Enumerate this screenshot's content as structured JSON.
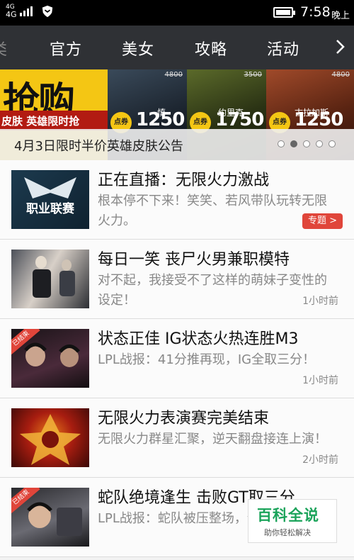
{
  "status_bar": {
    "network_top": "4G",
    "network": "4G",
    "time": "7:58",
    "ampm": "晚上"
  },
  "tabs": {
    "partial": "类",
    "items": [
      "官方",
      "美女",
      "攻略",
      "活动"
    ]
  },
  "banner": {
    "promo_big": "抢购",
    "promo_sub": "皮肤 英雄限时抢",
    "heroes": [
      {
        "name": "慎",
        "coin": "点券",
        "price": "1250",
        "old": "4800"
      },
      {
        "name": "约里克",
        "coin": "点券",
        "price": "1750",
        "old": "3500"
      },
      {
        "name": "古拉加斯",
        "coin": "点券",
        "price": "1250",
        "old": "4800"
      }
    ],
    "caption": "4月3日限时半价英雄皮肤公告",
    "slide_count": 5,
    "active_slide": 2
  },
  "news": [
    {
      "title": "正在直播：无限火力激战",
      "desc": "根本停不下来！笑笑、若风带队玩转无限火力。",
      "tag": "专题 >",
      "time": "",
      "thumb_text": "职业联赛",
      "ribbon": ""
    },
    {
      "title": "每日一笑 丧尸火男兼职模特",
      "desc": "对不起，我接受不了这样的萌妹子变性的设定！",
      "tag": "",
      "time": "1小时前",
      "thumb_text": "",
      "ribbon": ""
    },
    {
      "title": "状态正佳 IG状态火热连胜M3",
      "desc": "LPL战报：41分推再现，IG全取三分！",
      "tag": "",
      "time": "1小时前",
      "thumb_text": "",
      "ribbon": "已结束"
    },
    {
      "title": "无限火力表演赛完美结束",
      "desc": "无限火力群星汇聚，逆天翻盘接连上演！",
      "tag": "",
      "time": "2小时前",
      "thumb_text": "",
      "ribbon": ""
    },
    {
      "title": "蛇队绝境逢生 击败GT取三分",
      "desc": "LPL战报：蛇队被压整场，全取三分",
      "tag": "",
      "time": "",
      "thumb_text": "",
      "ribbon": "已结束"
    }
  ],
  "watermark": {
    "brand": "百科全说",
    "slogan": "助你轻松解决"
  },
  "colors": {
    "tabbar_bg": "#2f3135",
    "accent_red": "#e0453a",
    "brand_green": "#1aa35a",
    "promo_yellow": "#f4c614"
  }
}
